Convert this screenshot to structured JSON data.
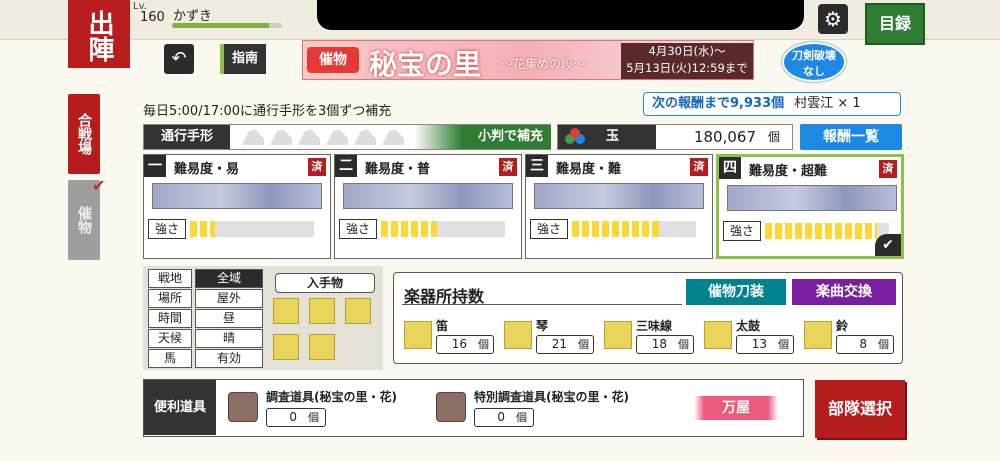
{
  "header": {
    "sortie_label": "出陣",
    "lv_label": "Lv.",
    "level": "160",
    "player_name": "かずき",
    "exp_fraction": 0.88,
    "settings_icon": "gear-icon",
    "catalog_label": "目録"
  },
  "nav": {
    "back_icon": "back-arrow-icon",
    "guide_label": "指南"
  },
  "event": {
    "tag": "催物",
    "title": "秘宝の里",
    "subtitle": "〜花集めの段〜",
    "start": "4月30日(水)〜",
    "end": "5月13日(火)12:59まで"
  },
  "break_badge": {
    "line1": "刀剣破壊",
    "line2": "なし"
  },
  "tabs": {
    "battlefield": "合戦場",
    "event": "催物"
  },
  "refill_text": "毎日5:00/17:00に通行手形を3個ずつ補充",
  "next_reward": {
    "prefix": "次の報酬まで9,933個",
    "reward": "村雲江 × 1"
  },
  "pass": {
    "label": "通行手形",
    "slots": 6,
    "oban_label": "小判で補充"
  },
  "gems": {
    "label": "玉",
    "icon": "tri-orb-icon",
    "count": "180,067",
    "unit": "個"
  },
  "reward_list_label": "報酬一覧",
  "difficulties": [
    {
      "num": "一",
      "title": "難易度・易",
      "done": "済",
      "strength_label": "強さ",
      "strength": 0.2,
      "selected": false
    },
    {
      "num": "二",
      "title": "難易度・普",
      "done": "済",
      "strength_label": "強さ",
      "strength": 0.45,
      "selected": false
    },
    {
      "num": "三",
      "title": "難易度・難",
      "done": "済",
      "strength_label": "強さ",
      "strength": 0.7,
      "selected": false
    },
    {
      "num": "四",
      "title": "難易度・超難",
      "done": "済",
      "strength_label": "強さ",
      "strength": 0.9,
      "selected": true
    }
  ],
  "terrain": {
    "keys": [
      "戦地",
      "場所",
      "時間",
      "天候",
      "馬"
    ],
    "values": [
      "全域",
      "屋外",
      "昼",
      "晴",
      "有効"
    ],
    "loot_label": "入手物"
  },
  "instruments": {
    "title": "楽器所持数",
    "seal_button": "催物刀装",
    "exchange_button": "楽曲交換",
    "items": [
      {
        "name": "笛",
        "count": "16",
        "unit": "個",
        "icon": "flute-icon"
      },
      {
        "name": "琴",
        "count": "21",
        "unit": "個",
        "icon": "koto-icon"
      },
      {
        "name": "三味線",
        "count": "18",
        "unit": "個",
        "icon": "shamisen-icon"
      },
      {
        "name": "太鼓",
        "count": "13",
        "unit": "個",
        "icon": "drum-icon"
      },
      {
        "name": "鈴",
        "count": "8",
        "unit": "個",
        "icon": "bell-icon"
      }
    ]
  },
  "tools": {
    "label": "便利道具",
    "items": [
      {
        "name": "調査道具(秘宝の里・花)",
        "count": "0",
        "unit": "個",
        "icon": "survey-kit-icon"
      },
      {
        "name": "特別調査道具(秘宝の里・花)",
        "count": "0",
        "unit": "個",
        "icon": "special-survey-kit-icon"
      }
    ],
    "shop_label": "万屋"
  },
  "squad_select_label": "部隊選択"
}
